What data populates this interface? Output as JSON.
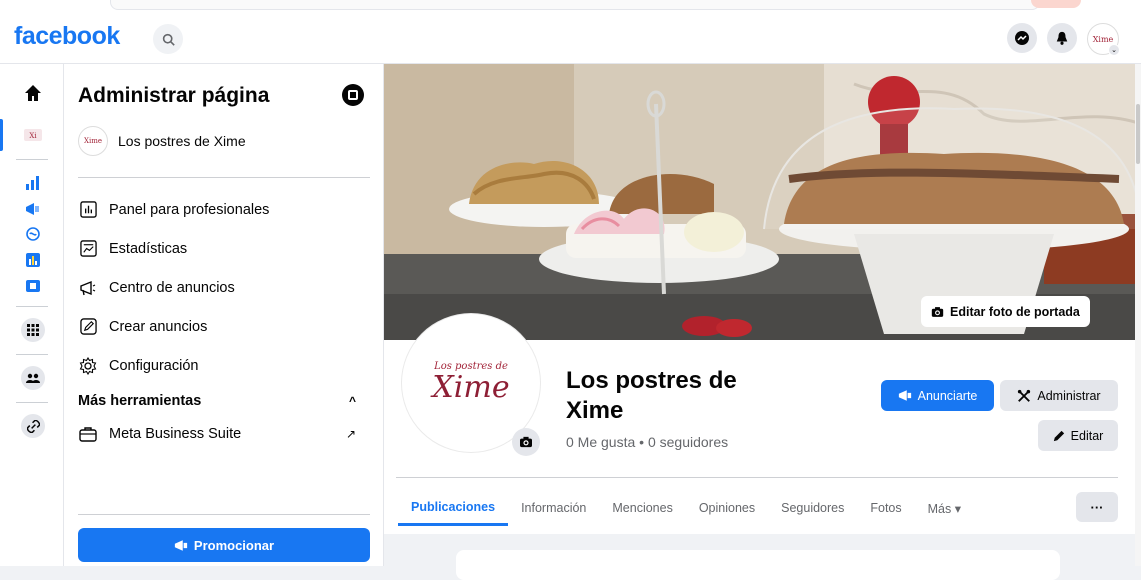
{
  "app": {
    "logo": "facebook"
  },
  "sidebar": {
    "title": "Administrar página",
    "page_name": "Los postres de Xime",
    "menu": [
      {
        "label": "Panel para profesionales",
        "icon": "dashboard-icon"
      },
      {
        "label": "Estadísticas",
        "icon": "insights-icon"
      },
      {
        "label": "Centro de anuncios",
        "icon": "megaphone-icon"
      },
      {
        "label": "Crear anuncios",
        "icon": "pencil-square-icon"
      },
      {
        "label": "Configuración",
        "icon": "gear-icon"
      }
    ],
    "more_tools": "Más herramientas",
    "meta_suite": "Meta Business Suite",
    "promote": "Promocionar"
  },
  "profile": {
    "avatar_line1": "Los postres de",
    "avatar_line2": "Xime",
    "name": "Los postres de Xime",
    "stats": "0 Me gusta • 0 seguidores",
    "edit_cover": "Editar foto de portada",
    "btn_advertise": "Anunciarte",
    "btn_manage": "Administrar",
    "btn_edit": "Editar"
  },
  "tabs": [
    {
      "label": "Publicaciones",
      "active": true
    },
    {
      "label": "Información"
    },
    {
      "label": "Menciones"
    },
    {
      "label": "Opiniones"
    },
    {
      "label": "Seguidores"
    },
    {
      "label": "Fotos"
    },
    {
      "label": "Más ▾"
    }
  ],
  "tab_more_btn": "···",
  "colors": {
    "brand": "#1877f2",
    "background": "#f0f2f5",
    "avatar_text": "#a3263a"
  }
}
